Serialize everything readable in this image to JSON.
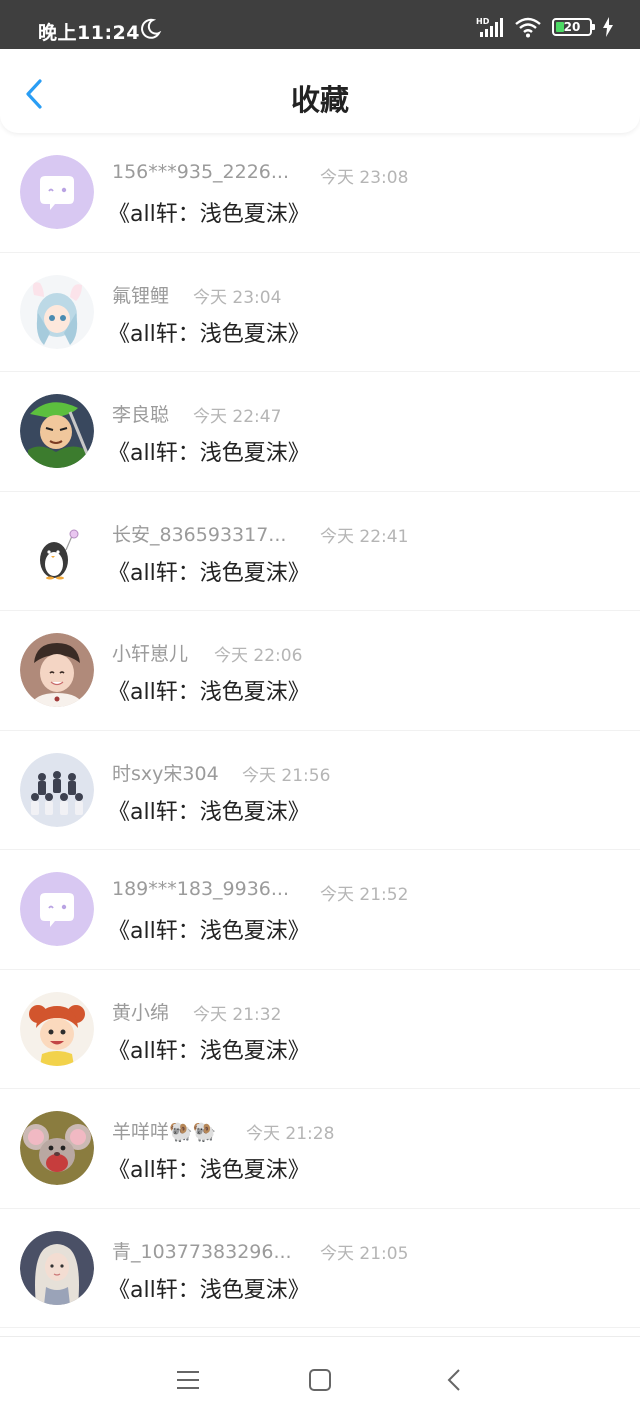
{
  "status_bar": {
    "time": "晚上11:24",
    "battery": "20",
    "icons": [
      "moon-icon",
      "hd-signal-icon",
      "wifi-icon",
      "battery-icon",
      "charging-icon"
    ]
  },
  "header": {
    "title": "收藏",
    "back_icon": "chevron-left-icon",
    "accent": "#2a9df4"
  },
  "items": [
    {
      "name": "156***935_2226...",
      "time": "今天 23:08",
      "content": "《all轩：浅色夏沫》",
      "avatar": "default-chat-avatar"
    },
    {
      "name": "氟锂鲤",
      "time": "今天 23:04",
      "content": "《all轩：浅色夏沫》",
      "avatar": "anime-girl-avatar"
    },
    {
      "name": "李良聪",
      "time": "今天 22:47",
      "content": "《all轩：浅色夏沫》",
      "avatar": "anime-swordsman-avatar"
    },
    {
      "name": "长安_836593317...",
      "time": "今天 22:41",
      "content": "《all轩：浅色夏沫》",
      "avatar": "penguin-avatar"
    },
    {
      "name": "小轩崽儿",
      "time": "今天 22:06",
      "content": "《all轩：浅色夏沫》",
      "avatar": "boy-photo-avatar"
    },
    {
      "name": "时sxy宋304",
      "time": "今天 21:56",
      "content": "《all轩：浅色夏沫》",
      "avatar": "group-photo-avatar"
    },
    {
      "name": "189***183_9936...",
      "time": "今天 21:52",
      "content": "《all轩：浅色夏沫》",
      "avatar": "default-chat-avatar"
    },
    {
      "name": "黄小绵",
      "time": "今天 21:32",
      "content": "《all轩：浅色夏沫》",
      "avatar": "cartoon-girl-avatar"
    },
    {
      "name": "羊咩咩🐏🐏",
      "time": "今天 21:28",
      "content": "《all轩：浅色夏沫》",
      "avatar": "cartoon-mouse-avatar"
    },
    {
      "name": "青_10377383296...",
      "time": "今天 21:05",
      "content": "《all轩：浅色夏沫》",
      "avatar": "girl-photo-avatar"
    }
  ],
  "nav_bar": {
    "icons": [
      "menu-icon",
      "home-square-icon",
      "back-triangle-icon"
    ]
  }
}
